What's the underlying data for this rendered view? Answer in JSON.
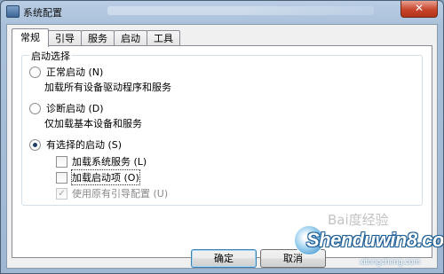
{
  "window": {
    "title": "系统配置",
    "close_glyph": "✕"
  },
  "tabs": [
    {
      "label": "常规",
      "active": true
    },
    {
      "label": "引导",
      "active": false
    },
    {
      "label": "服务",
      "active": false
    },
    {
      "label": "启动",
      "active": false
    },
    {
      "label": "工具",
      "active": false
    }
  ],
  "startup_group": {
    "title": "启动选择",
    "normal": {
      "label": "正常启动 (N)",
      "description": "加载所有设备驱动程序和服务",
      "checked": false
    },
    "diagnostic": {
      "label": "诊断启动 (D)",
      "description": "仅加载基本设备和服务",
      "checked": false
    },
    "selective": {
      "label": "有选择的启动 (S)",
      "checked": true,
      "options": [
        {
          "label": "加载系统服务 (L)",
          "checked": false,
          "disabled": false
        },
        {
          "label": "加载启动项 (O)",
          "checked": false,
          "disabled": false
        },
        {
          "label": "使用原有引导配置 (U)",
          "checked": true,
          "disabled": true
        }
      ]
    }
  },
  "buttons": {
    "ok": "确定",
    "cancel": "取消"
  },
  "icons": {
    "check_glyph": "✓"
  }
}
